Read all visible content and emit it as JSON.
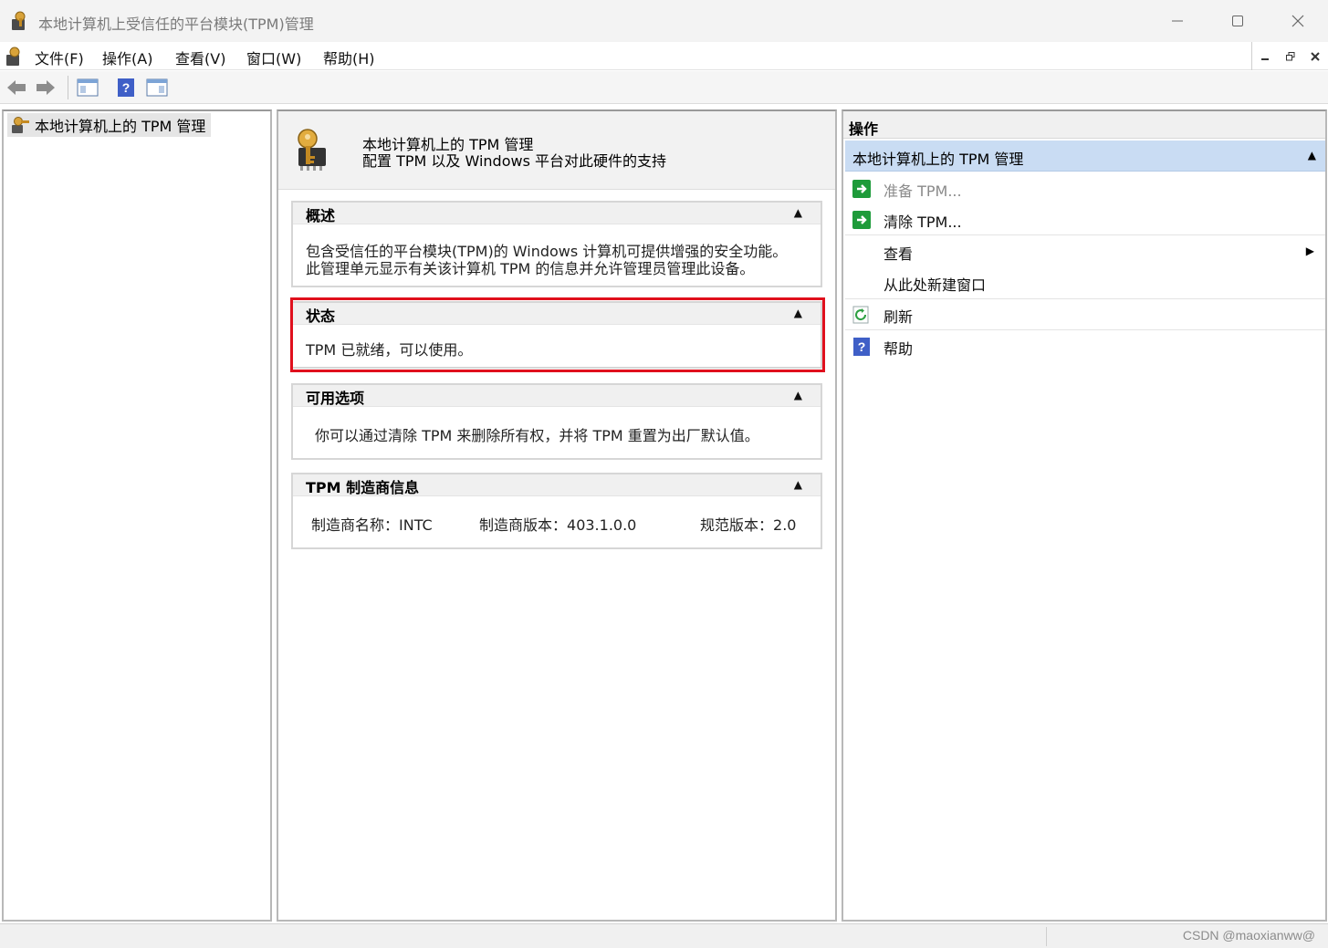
{
  "window": {
    "title": "本地计算机上受信任的平台模块(TPM)管理"
  },
  "menubar": {
    "items": [
      "文件(F)",
      "操作(A)",
      "查看(V)",
      "窗口(W)",
      "帮助(H)"
    ]
  },
  "tree": {
    "root_label": "本地计算机上的 TPM 管理"
  },
  "center": {
    "header_title": "本地计算机上的 TPM 管理",
    "header_subtitle": "配置 TPM 以及 Windows 平台对此硬件的支持",
    "overview": {
      "title": "概述",
      "line1": "包含受信任的平台模块(TPM)的 Windows 计算机可提供增强的安全功能。",
      "line2": "此管理单元显示有关该计算机 TPM 的信息并允许管理员管理此设备。"
    },
    "status": {
      "title": "状态",
      "text": "TPM 已就绪，可以使用。"
    },
    "options": {
      "title": "可用选项",
      "text": "你可以通过清除 TPM 来删除所有权，并将 TPM 重置为出厂默认值。"
    },
    "manufacturer": {
      "title": "TPM 制造商信息",
      "name_label": "制造商名称：",
      "name_value": "INTC",
      "version_label": "制造商版本：",
      "version_value": "403.1.0.0",
      "spec_label": "规范版本：",
      "spec_value": "2.0"
    }
  },
  "actions": {
    "header": "操作",
    "group_label": "本地计算机上的 TPM 管理",
    "items": [
      {
        "label": "准备 TPM...",
        "icon": "green-arrow-icon",
        "disabled": true
      },
      {
        "label": "清除 TPM...",
        "icon": "green-arrow-icon",
        "disabled": false
      },
      {
        "label": "查看",
        "icon": "",
        "submenu": true
      },
      {
        "label": "从此处新建窗口",
        "icon": ""
      },
      {
        "label": "刷新",
        "icon": "refresh-icon"
      },
      {
        "label": "帮助",
        "icon": "help-icon"
      }
    ]
  },
  "statusbar": {
    "watermark": "CSDN @maoxianww@"
  },
  "colors": {
    "highlight_border": "#e0101d",
    "action_group_bg": "#c9dcf3",
    "action_icon_green": "#1e9b3a",
    "help_icon_blue": "#3f5fc7"
  }
}
